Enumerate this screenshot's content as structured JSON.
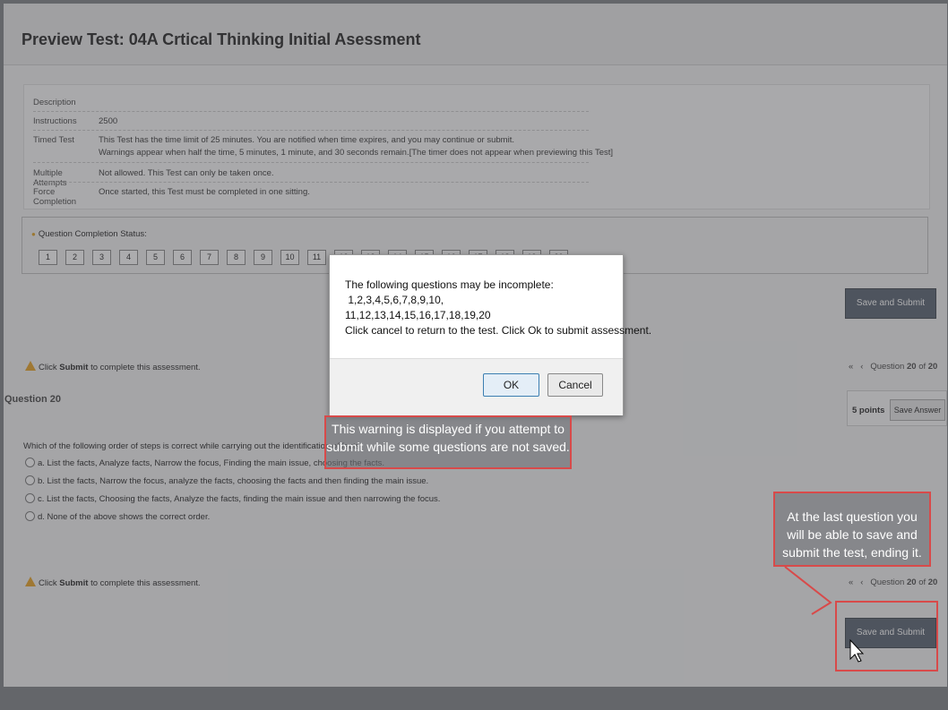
{
  "page_title": "Preview Test: 04A Crtical Thinking Initial Asessment",
  "description": {
    "rows": [
      {
        "key": "Description",
        "value": ""
      },
      {
        "key": "Instructions",
        "value": "2500"
      },
      {
        "key": "Timed Test",
        "value": "This Test has the time limit of 25 minutes. You are notified when time expires, and you may continue or submit.",
        "line2": "Warnings appear when half the time, 5 minutes, 1 minute, and 30 seconds remain.[The timer does not appear when previewing this Test]"
      },
      {
        "key": "Multiple Attempts",
        "value": "Not allowed. This Test can only be taken once."
      },
      {
        "key": "Force Completion",
        "value": "Once started, this Test must be completed in one sitting."
      }
    ]
  },
  "completion": {
    "title": "Question Completion Status:",
    "questions": [
      "1",
      "2",
      "3",
      "4",
      "5",
      "6",
      "7",
      "8",
      "9",
      "10",
      "11",
      "12",
      "13",
      "14",
      "15",
      "16",
      "17",
      "18",
      "19",
      "20"
    ]
  },
  "save_submit_label": "Save and Submit",
  "submit_warning": {
    "prefix": "Click ",
    "bold": "Submit",
    "suffix": " to complete this assessment."
  },
  "nav": {
    "first": "«",
    "prev": "‹",
    "label": "Question ",
    "current": "20",
    "of": " of ",
    "total": "20"
  },
  "question": {
    "title": "Question 20",
    "points": "5 points",
    "save_answer": "Save Answer",
    "text": "Which of the following order of steps is correct while carrying out the identification of facts",
    "options": [
      "a. List the facts, Analyze facts, Narrow the focus, Finding the main issue, choosing the facts.",
      "b. List the facts, Narrow the focus, analyze the facts, choosing the facts and then finding the main issue.",
      "c. List the facts, Choosing the facts, Analyze the facts, finding the main issue and then narrowing the focus.",
      "d. None of the above shows the correct order."
    ]
  },
  "dialog": {
    "message": "The following questions may be incomplete:\n 1,2,3,4,5,6,7,8,9,10,\n11,12,13,14,15,16,17,18,19,20\nClick cancel to return to the test. Click Ok to submit assessment.",
    "ok": "OK",
    "cancel": "Cancel"
  },
  "callouts": {
    "warning": "This warning is displayed if you attempt to submit while some questions are not saved.",
    "last": "At the last question you will be able to save and submit the test, ending it."
  },
  "colors": {
    "callout_border": "#d84a4a",
    "button": "#55606d",
    "warning_icon": "#e8a020"
  }
}
